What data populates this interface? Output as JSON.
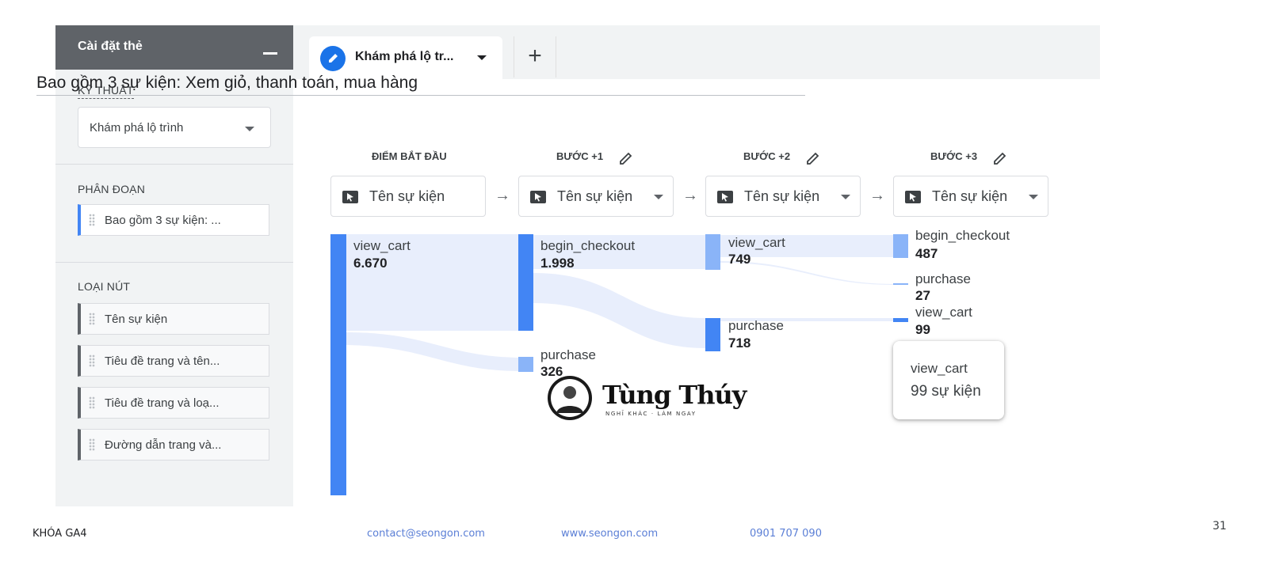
{
  "left_panel": {
    "title": "Cài đặt thẻ",
    "technique": {
      "label": "KỸ THUẬT",
      "selected": "Khám phá lộ trình"
    },
    "segment": {
      "label": "PHÂN ĐOẠN",
      "chip": "Bao gồm 3 sự kiện: ..."
    },
    "node_type": {
      "label": "LOẠI NÚT",
      "items": [
        "Tên sự kiện",
        "Tiêu đề trang và tên...",
        "Tiêu đề trang và loạ...",
        "Đường dẫn trang và..."
      ]
    }
  },
  "tab": {
    "label": "Khám phá lộ tr...",
    "add": "+"
  },
  "headline": "Bao gồm 3 sự kiện: Xem giỏ, thanh toán, mua hàng",
  "steps": [
    {
      "label": "ĐIỂM BẮT ĐẦU",
      "node_type": "Tên sự kiện"
    },
    {
      "label": "BƯỚC +1",
      "node_type": "Tên sự kiện"
    },
    {
      "label": "BƯỚC +2",
      "node_type": "Tên sự kiện"
    },
    {
      "label": "BƯỚC +3",
      "node_type": "Tên sự kiện"
    }
  ],
  "arrow": "→",
  "nodes": {
    "s0_view_cart": {
      "name": "view_cart",
      "value": "6.670"
    },
    "s1_begin_checkout": {
      "name": "begin_checkout",
      "value": "1.998"
    },
    "s1_purchase": {
      "name": "purchase",
      "value": "326"
    },
    "s2_view_cart": {
      "name": "view_cart",
      "value": "749"
    },
    "s2_purchase": {
      "name": "purchase",
      "value": "718"
    },
    "s3_begin_checkout": {
      "name": "begin_checkout",
      "value": "487"
    },
    "s3_purchase": {
      "name": "purchase",
      "value": "27"
    },
    "s3_view_cart": {
      "name": "view_cart",
      "value": "99"
    }
  },
  "tooltip": {
    "name": "view_cart",
    "value": "99 sự kiện"
  },
  "logo": {
    "text": "Tùng Thúy",
    "tagline": "NGHĨ KHÁC · LÀM NGAY"
  },
  "footer": {
    "course": "KHÓA GA4",
    "email": "contact@seongon.com",
    "website": "www.seongon.com",
    "phone": "0901 707 090",
    "page": "31"
  },
  "colors": {
    "node": "#4285f4",
    "node_light": "#8ab4f8",
    "flow": "#e8eefc",
    "header": "#5f6368"
  }
}
